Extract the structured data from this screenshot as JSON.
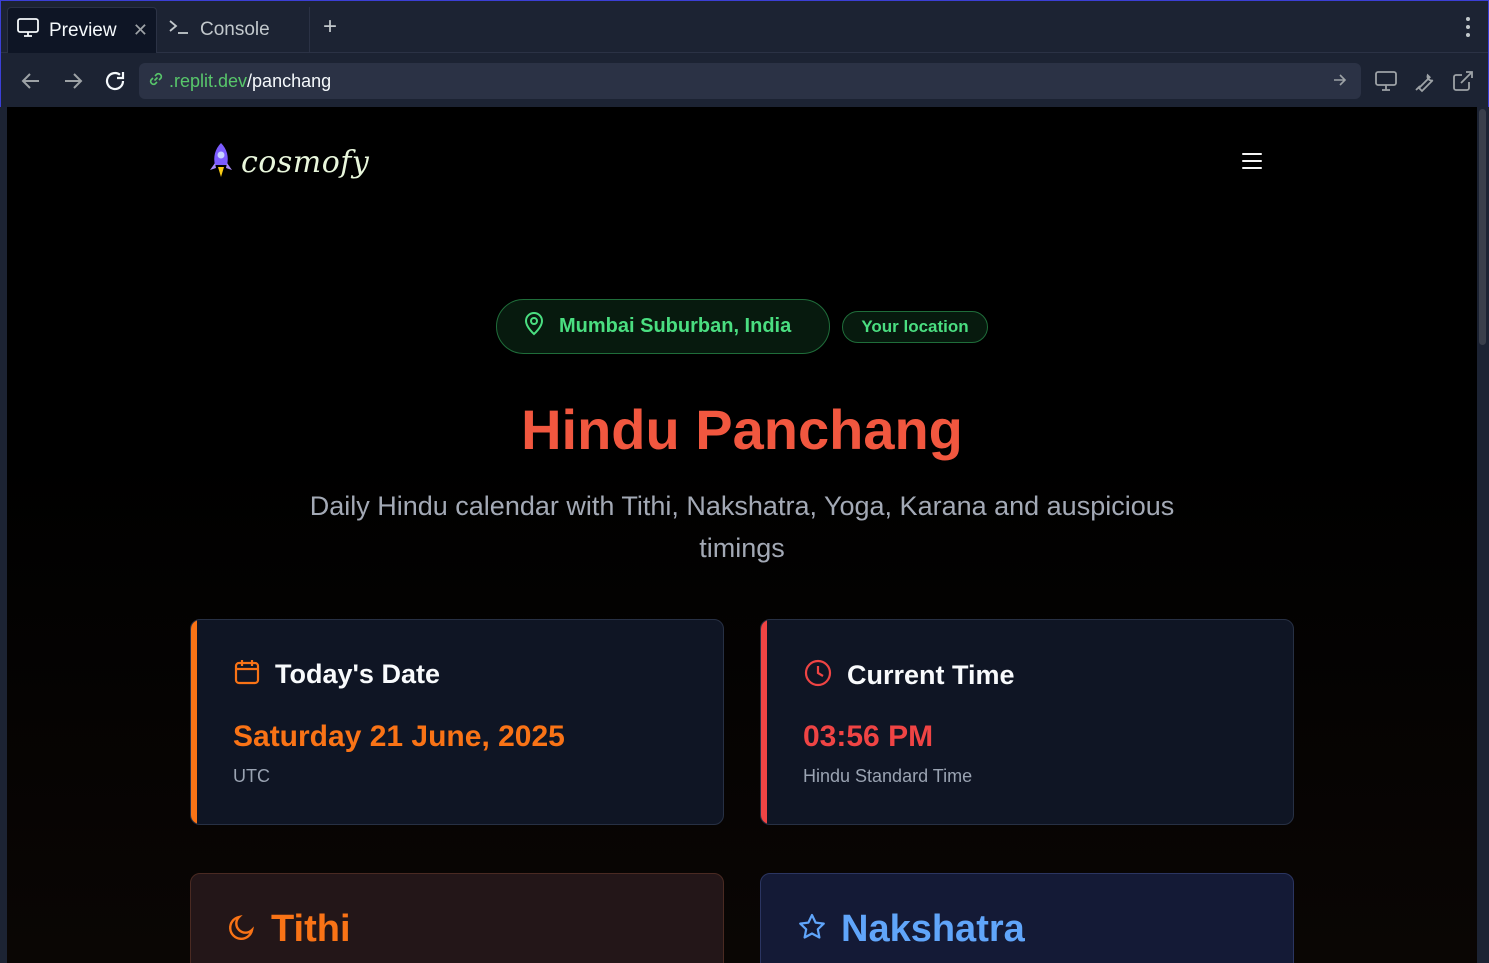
{
  "browser": {
    "tabs": [
      {
        "label": "Preview",
        "icon": "monitor-icon",
        "active": true
      },
      {
        "label": "Console",
        "icon": "terminal-icon",
        "active": false
      }
    ],
    "url": {
      "host": ".replit.dev",
      "path": "/panchang"
    }
  },
  "site": {
    "logo_text": "cosmofy",
    "logo_icon": "rocket-icon",
    "menu_icon": "hamburger-icon"
  },
  "location": {
    "name": "Mumbai Suburban, India",
    "badge": "Your location"
  },
  "hero": {
    "title": "Hindu Panchang",
    "subtitle": "Daily Hindu calendar with Tithi, Nakshatra, Yoga, Karana and auspicious timings"
  },
  "cards": {
    "date": {
      "heading": "Today's Date",
      "value": "Saturday 21 June, 2025",
      "note": "UTC"
    },
    "time": {
      "heading": "Current Time",
      "value": "03:56 PM",
      "note": "Hindu Standard Time"
    },
    "tithi": {
      "heading": "Tithi"
    },
    "nakshatra": {
      "heading": "Nakshatra"
    }
  },
  "colors": {
    "accent_orange": "#f97316",
    "accent_red": "#ef4444",
    "accent_green": "#4ade80",
    "accent_blue": "#60a5fa"
  }
}
